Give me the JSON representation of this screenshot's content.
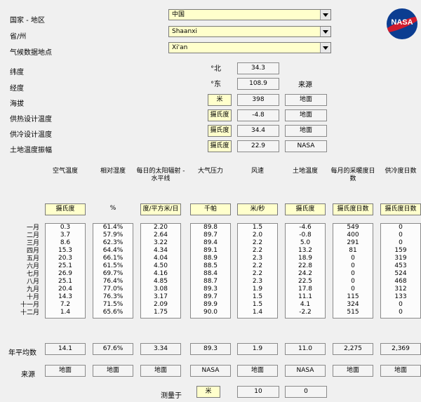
{
  "labels": {
    "country": "国家 - 地区",
    "province": "省/州",
    "station": "气候数据地点",
    "latitude": "纬度",
    "longitude": "经度",
    "elevation": "海拔",
    "heat_design": "供热设计温度",
    "cool_design": "供冷设计温度",
    "ground_amp": "土地温度振幅",
    "annual": "年平均数",
    "source": "来源",
    "measured_at": "测量于",
    "source_header": "来源"
  },
  "selects": {
    "country": "中国",
    "province": "Shaanxi",
    "station": "Xi'an"
  },
  "location": {
    "lat_dir": "°北",
    "lat": "34.3",
    "lon_dir": "°东",
    "lon": "108.9",
    "elev_unit": "米",
    "elev": "398",
    "elev_src": "地面",
    "heat_unit": "摄氏度",
    "heat": "-4.8",
    "heat_src": "地面",
    "cool_unit": "摄氏度",
    "cool": "34.4",
    "cool_src": "地面",
    "amp_unit": "摄氏度",
    "amp": "22.9",
    "amp_src": "NASA"
  },
  "columns": [
    {
      "header": "空气温度",
      "unit": "摄氏度",
      "values": [
        "0.3",
        "3.7",
        "8.6",
        "15.3",
        "20.3",
        "25.1",
        "26.9",
        "25.1",
        "20.4",
        "14.3",
        "7.2",
        "1.4"
      ],
      "annual": "14.1",
      "source": "地面"
    },
    {
      "header": "相对湿度",
      "unit": "%",
      "values": [
        "61.4%",
        "57.9%",
        "62.3%",
        "64.4%",
        "66.1%",
        "61.5%",
        "69.7%",
        "76.4%",
        "77.0%",
        "76.3%",
        "71.5%",
        "65.6%"
      ],
      "annual": "67.6%",
      "source": "地面"
    },
    {
      "header": "每日的太阳辐射 - 水平线",
      "unit": "度/平方米/日",
      "values": [
        "2.20",
        "2.64",
        "3.22",
        "4.34",
        "4.04",
        "4.50",
        "4.16",
        "4.85",
        "3.08",
        "3.17",
        "2.09",
        "1.75"
      ],
      "annual": "3.34",
      "source": "地面"
    },
    {
      "header": "大气压力",
      "unit": "千帕",
      "values": [
        "89.8",
        "89.7",
        "89.4",
        "89.1",
        "88.9",
        "88.5",
        "88.4",
        "88.7",
        "89.3",
        "89.7",
        "89.9",
        "90.0"
      ],
      "annual": "89.3",
      "source": "NASA"
    },
    {
      "header": "风速",
      "unit": "米/秒",
      "values": [
        "1.5",
        "2.0",
        "2.2",
        "2.2",
        "2.3",
        "2.2",
        "2.2",
        "2.3",
        "1.9",
        "1.5",
        "1.5",
        "1.4"
      ],
      "annual": "1.9",
      "source": "地面"
    },
    {
      "header": "土地温度",
      "unit": "摄氏度",
      "values": [
        "-4.6",
        "-0.8",
        "5.0",
        "13.2",
        "18.9",
        "22.8",
        "24.2",
        "22.5",
        "17.8",
        "11.1",
        "4.1",
        "-2.2"
      ],
      "annual": "11.0",
      "source": "NASA"
    },
    {
      "header": "每月的采暖度日数",
      "unit": "摄氏度日数",
      "values": [
        "549",
        "400",
        "291",
        "81",
        "0",
        "0",
        "0",
        "0",
        "0",
        "115",
        "324",
        "515"
      ],
      "annual": "2,275",
      "source": "地面"
    },
    {
      "header": "供冷度日数",
      "unit": "摄氏度日数",
      "values": [
        "0",
        "0",
        "0",
        "159",
        "319",
        "453",
        "524",
        "468",
        "312",
        "133",
        "0",
        "0"
      ],
      "annual": "2,369",
      "source": "地面"
    }
  ],
  "months": [
    "一月",
    "二月",
    "三月",
    "四月",
    "五月",
    "六月",
    "七月",
    "八月",
    "九月",
    "十月",
    "十一月",
    "十二月"
  ],
  "measured": {
    "unit": "米",
    "wind_height": "10",
    "ground_depth": "0"
  },
  "logo": "NASA"
}
